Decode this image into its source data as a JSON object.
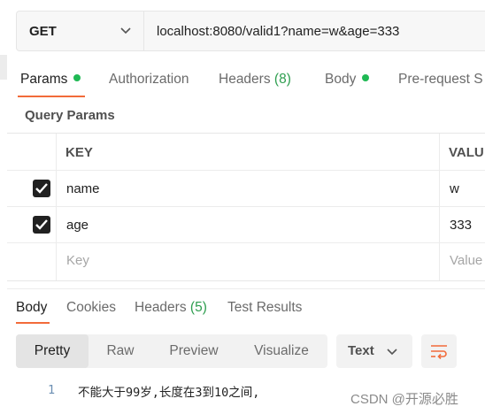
{
  "request": {
    "method": "GET",
    "url": "localhost:8080/valid1?name=w&age=333"
  },
  "request_tabs": [
    {
      "label": "Params",
      "active": true,
      "dot": true
    },
    {
      "label": "Authorization"
    },
    {
      "label": "Headers",
      "count": "(8)"
    },
    {
      "label": "Body",
      "dot": true
    },
    {
      "label": "Pre-request S"
    }
  ],
  "query_params": {
    "title": "Query Params",
    "columns": {
      "key": "KEY",
      "value": "VALU"
    },
    "rows": [
      {
        "checked": true,
        "key": "name",
        "value": "w"
      },
      {
        "checked": true,
        "key": "age",
        "value": "333"
      }
    ],
    "placeholder": {
      "key": "Key",
      "value": "Value"
    }
  },
  "response_tabs": [
    {
      "label": "Body",
      "active": true
    },
    {
      "label": "Cookies"
    },
    {
      "label": "Headers",
      "count": "(5)"
    },
    {
      "label": "Test Results"
    }
  ],
  "view_modes": [
    {
      "label": "Pretty",
      "active": true
    },
    {
      "label": "Raw"
    },
    {
      "label": "Preview"
    },
    {
      "label": "Visualize"
    }
  ],
  "format": {
    "selected": "Text"
  },
  "response_body": {
    "line_number": "1",
    "text": "不能大于99岁,长度在3到10之间,"
  },
  "watermark": "CSDN @开源必胜",
  "colors": {
    "accent": "#f26b3a",
    "green": "#1fb954"
  },
  "icons": {
    "chevron": "chevron-down-icon",
    "wrap": "wrap-lines-icon",
    "check": "checkmark-icon"
  }
}
